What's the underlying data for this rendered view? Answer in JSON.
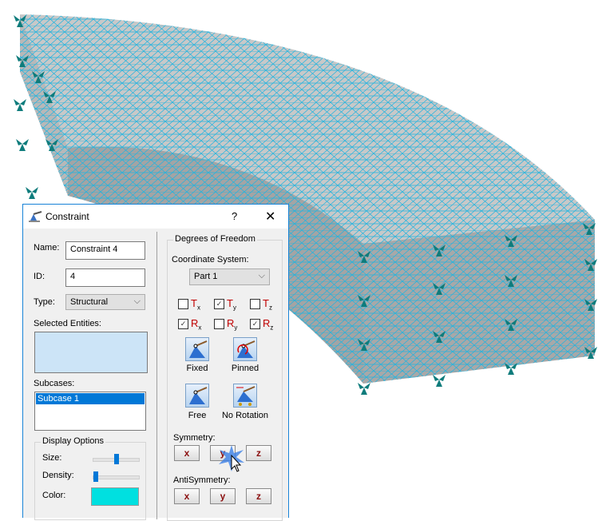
{
  "dialog": {
    "title": "Constraint",
    "help": "?",
    "close": "✕",
    "name_label": "Name:",
    "name_value": "Constraint 4",
    "id_label": "ID:",
    "id_value": "4",
    "type_label": "Type:",
    "type_value": "Structural",
    "selected_label": "Selected Entities:",
    "subcases_label": "Subcases:",
    "subcases": [
      "Subcase 1"
    ],
    "display_options": {
      "legend": "Display Options",
      "size_label": "Size:",
      "size_value": 0.5,
      "density_label": "Density:",
      "density_value": 0.0,
      "color_label": "Color:",
      "color": "#00e0e0"
    },
    "dof": {
      "legend": "Degrees of Freedom",
      "coord_label": "Coordinate System:",
      "coord_value": "Part 1",
      "checks": [
        {
          "l": "T",
          "s": "x",
          "on": false
        },
        {
          "l": "T",
          "s": "y",
          "on": true
        },
        {
          "l": "T",
          "s": "z",
          "on": false
        },
        {
          "l": "R",
          "s": "x",
          "on": true
        },
        {
          "l": "R",
          "s": "y",
          "on": false
        },
        {
          "l": "R",
          "s": "z",
          "on": true
        }
      ],
      "presets": [
        "Fixed",
        "Pinned",
        "Free",
        "No Rotation"
      ],
      "symmetry_label": "Symmetry:",
      "antisymmetry_label": "AntiSymmetry:",
      "axes": [
        "x",
        "y",
        "z"
      ]
    }
  }
}
